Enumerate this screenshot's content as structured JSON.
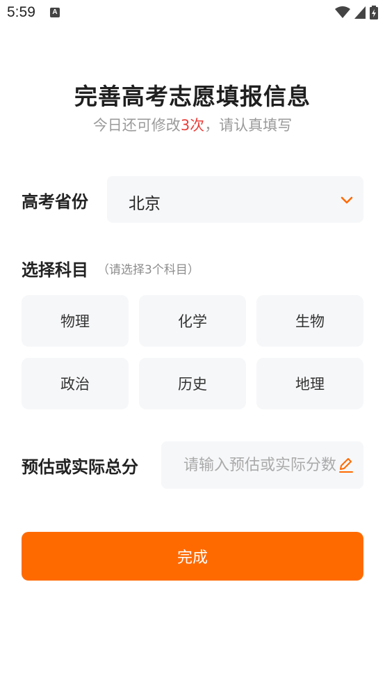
{
  "status_bar": {
    "time": "5:59",
    "notification_glyph": "A",
    "icons": [
      "wifi-icon",
      "signal-icon",
      "battery-charging-icon"
    ]
  },
  "header": {
    "title": "完善高考志愿填报信息",
    "subtitle_prefix": "今日还可修改",
    "subtitle_count": "3次",
    "subtitle_suffix": "，请认真填写",
    "highlight_color": "#e8413c"
  },
  "province": {
    "label": "高考省份",
    "value": "北京",
    "icon": "chevron-down-icon"
  },
  "subjects": {
    "label": "选择科目",
    "hint": "（请选择3个科目）",
    "items": [
      "物理",
      "化学",
      "生物",
      "政治",
      "历史",
      "地理"
    ]
  },
  "score": {
    "label": "预估或实际总分",
    "placeholder": "请输入预估或实际分数",
    "value": "",
    "icon": "edit-icon"
  },
  "submit": {
    "label": "完成",
    "color": "#ff6a00"
  }
}
